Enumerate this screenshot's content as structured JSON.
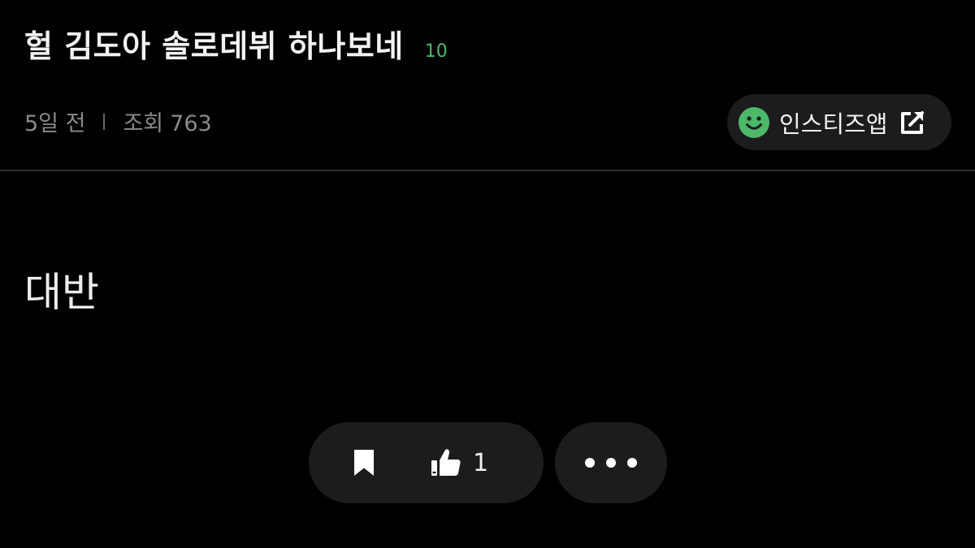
{
  "post": {
    "title": "헐 김도아 솔로데뷔 하나보네",
    "comment_count": "10",
    "time_ago": "5일 전",
    "views_label": "조회",
    "views_count": "763",
    "body": "대반"
  },
  "app_button": {
    "label": "인스티즈앱",
    "icon": "smile-icon",
    "trailing_icon": "external-link-icon"
  },
  "actions": {
    "like_count": "1",
    "bookmark_icon": "bookmark-icon",
    "like_icon": "thumbs-up-icon",
    "more_icon": "more-dots-icon"
  },
  "colors": {
    "background": "#000000",
    "surface": "#1c1c1e",
    "accent_green": "#4cb96a",
    "meta_text": "#8a8a8e",
    "divider": "#2e2e36"
  }
}
